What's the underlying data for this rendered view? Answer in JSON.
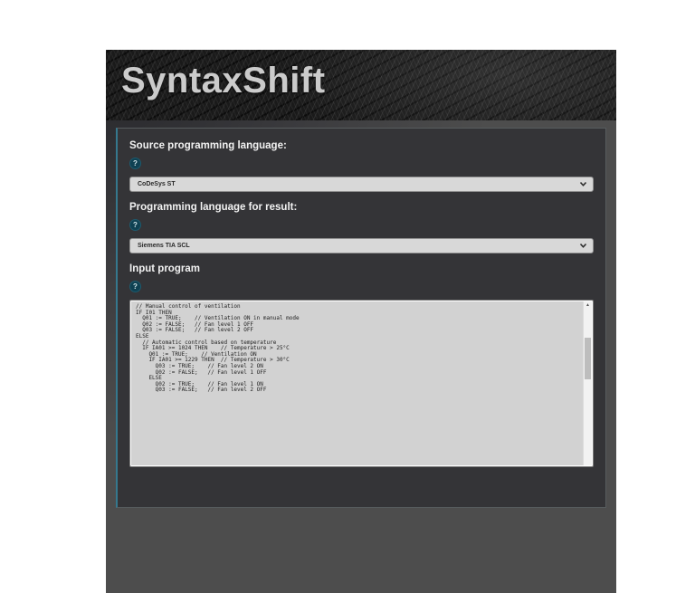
{
  "app": {
    "title": "SyntaxShift"
  },
  "form": {
    "source": {
      "label": "Source programming language:",
      "help": "?",
      "value": "CoDeSys ST"
    },
    "target": {
      "label": "Programming language for result:",
      "help": "?",
      "value": "Siemens TIA SCL"
    },
    "program": {
      "label": "Input program",
      "help": "?",
      "value": "// Manual control of ventilation\nIF I01 THEN\n  Q01 := TRUE;    // Ventilation ON in manual mode\n  Q02 := FALSE;   // Fan level 1 OFF\n  Q03 := FALSE;   // Fan level 2 OFF\nELSE\n  // Automatic control based on temperature\n  IF IA01 >= 1024 THEN    // Temperature > 25°C\n    Q01 := TRUE;    // Ventilation ON\n    IF IA01 >= 1229 THEN  // Temperature > 30°C\n      Q03 := TRUE;    // Fan level 2 ON\n      Q02 := FALSE;   // Fan level 1 OFF\n    ELSE\n      Q02 := TRUE;    // Fan level 1 ON\n      Q03 := FALSE;   // Fan level 2 OFF"
    }
  },
  "icons": {
    "scroll_up_arrow": "▲"
  },
  "colors": {
    "accent_teal": "#35788e",
    "help_badge_bg": "#0f4152",
    "panel_bg": "#343437",
    "container_bg": "#4d4d4d",
    "select_bg": "#d8d8d8",
    "textarea_bg": "#d2d2d2",
    "title_color": "#cbcbcb"
  }
}
